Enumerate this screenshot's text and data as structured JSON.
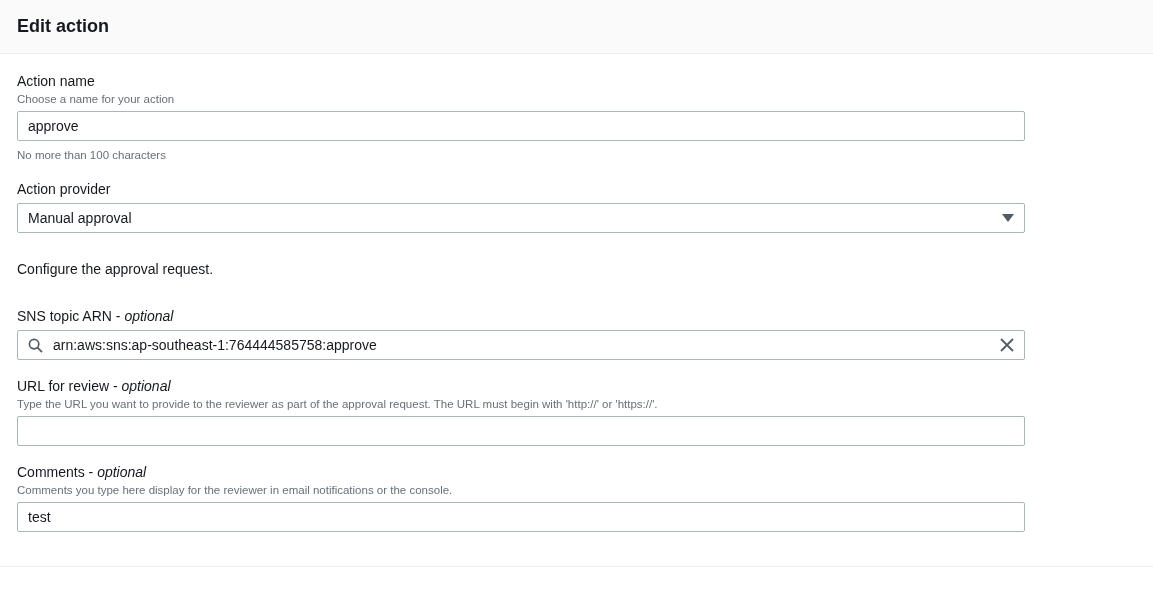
{
  "header": {
    "title": "Edit action"
  },
  "fields": [
    {
      "kind": "text",
      "label": "Action name",
      "description": "Choose a name for your action",
      "value": "approve",
      "constraint": "No more than 100 characters"
    },
    {
      "kind": "select",
      "label": "Action provider",
      "value": "Manual approval"
    },
    {
      "kind": "note",
      "text": "Configure the approval request."
    },
    {
      "kind": "search",
      "label": "SNS topic ARN - *optional*",
      "value": "arn:aws:sns:ap-southeast-1:764444585758:approve"
    },
    {
      "kind": "text",
      "label": "URL for review - *optional*",
      "description": "Type the URL you want to provide to the reviewer as part of the approval request. The URL must begin with 'http://' or 'https://'."
    },
    {
      "kind": "text",
      "label": "Comments - *optional*",
      "description": "Comments you type here display for the reviewer in email notifications or the console.",
      "value": "test"
    }
  ]
}
